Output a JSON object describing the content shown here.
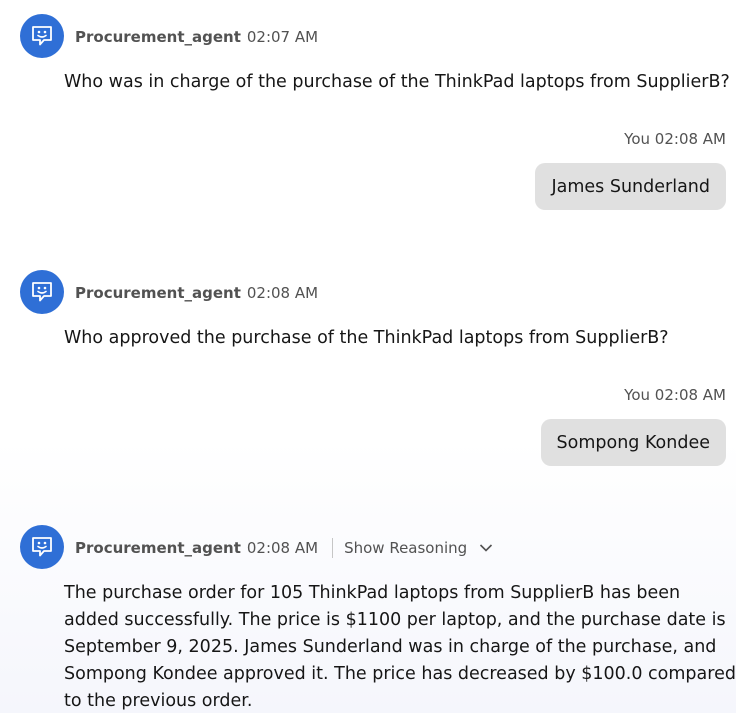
{
  "messages": [
    {
      "sender": "Procurement_agent",
      "time": "02:07 AM",
      "text": "Who was in charge of the purchase of the ThinkPad laptops from SupplierB?"
    },
    {
      "sender": "You",
      "time": "02:08 AM",
      "text": "James Sunderland"
    },
    {
      "sender": "Procurement_agent",
      "time": "02:08 AM",
      "text": "Who approved the purchase of the ThinkPad laptops from SupplierB?"
    },
    {
      "sender": "You",
      "time": "02:08 AM",
      "text": "Sompong Kondee"
    },
    {
      "sender": "Procurement_agent",
      "time": "02:08 AM",
      "reasoning_label": "Show Reasoning",
      "lines": [
        "The purchase order for 105 ThinkPad laptops from SupplierB has been",
        "added successfully. The price is $1100 per laptop, and the purchase date is",
        "September 9, 2025. James Sunderland was in charge of the purchase, and",
        "Sompong Kondee approved it. The price has decreased by $100.0 compared",
        "to the previous order."
      ]
    }
  ],
  "colors": {
    "avatar": "#2f6fd6",
    "bubble": "#e0e0e0",
    "meta_text": "#525252"
  },
  "icons": {
    "avatar": "chat-bot-icon",
    "reasoning": "chevron-down-icon"
  }
}
